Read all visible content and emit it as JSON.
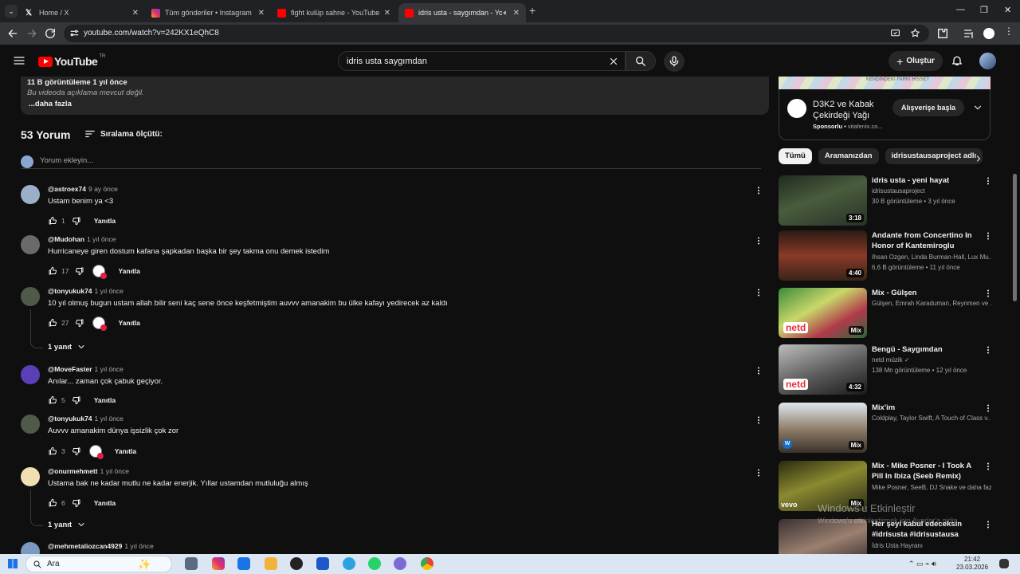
{
  "browser": {
    "tabs": [
      {
        "title": "Home / X",
        "icon": "x-logo-icon",
        "color": "#ffffff"
      },
      {
        "title": "Tüm gönderiler • Instagram",
        "icon": "instagram-icon",
        "color": "#e1306c"
      },
      {
        "title": "fight kulüp sahne - YouTube",
        "icon": "youtube-icon",
        "color": "#ff0000"
      },
      {
        "title": "idris usta - saygımdan - You",
        "icon": "youtube-icon",
        "color": "#ff0000",
        "active": true
      }
    ],
    "url": "youtube.com/watch?v=242KX1eQhC8"
  },
  "youtube": {
    "logo_text": "YouTube",
    "region": "TR",
    "search_query": "idris usta saygımdan",
    "create_label": "Oluştur"
  },
  "description": {
    "meta": "11 B görüntüleme  1 yıl önce",
    "no_description": "Bu videoda açıklama mevcut değil.",
    "more": "...daha fazla"
  },
  "comments_section": {
    "count_label": "53 Yorum",
    "sort_label": "Sıralama ölçütü:",
    "add_placeholder": "Yorum ekleyin...",
    "reply_label": "Yanıtla",
    "comments": [
      {
        "handle": "@astroex74",
        "age": "9 ay önce",
        "text": "Ustam benim ya <3",
        "likes": "1",
        "creator_heart": false,
        "avatar": "#9ab0c8"
      },
      {
        "handle": "@Mudohan",
        "age": "1 yıl önce",
        "text": "Hurricaneye giren dostum kafana şapkadan başka bir şey takma onu demek istedim",
        "likes": "17",
        "creator_heart": true,
        "avatar": "#6a6a6a"
      },
      {
        "handle": "@tonyukuk74",
        "age": "1 yıl önce",
        "text": "10 yıl olmuş bugun ustam allah bilir seni kaç sene önce keşfetmiştim auvvv amanakim bu ülke kafayı yedirecek az kaldı",
        "likes": "27",
        "creator_heart": true,
        "avatar": "#4f5a4a",
        "replies": "1 yanıt"
      },
      {
        "handle": "@MoveFaster",
        "age": "1 yıl önce",
        "text": "Anılar... zaman çok çabuk geçiyor.",
        "likes": "5",
        "creator_heart": false,
        "avatar": "#5b3fb8"
      },
      {
        "handle": "@tonyukuk74",
        "age": "1 yıl önce",
        "text": "Auvvv amanakim dünya işsizlik çok zor",
        "likes": "3",
        "creator_heart": true,
        "avatar": "#4f5a4a"
      },
      {
        "handle": "@onurmehmett",
        "age": "1 yıl önce",
        "text": "Ustama bak ne kadar mutlu ne kadar enerjik. Yıllar ustamdan mutluluğu almış",
        "likes": "6",
        "creator_heart": false,
        "avatar": "#f0dfb0",
        "replies": "1 yanıt"
      },
      {
        "handle": "@mehmetaliozcan4929",
        "age": "1 yıl önce",
        "text": "",
        "likes": "",
        "creator_heart": false,
        "avatar": "#7a98c0"
      }
    ]
  },
  "ad": {
    "banner_text": "KENDINDEKI FARKI HISSET",
    "title": "D3K2 ve Kabak Çekirdeği Yağı",
    "sponsored": "Sponsorlu",
    "advertiser": "vitafenix.co...",
    "cta": "Alışverişe başla"
  },
  "chips": [
    "Tümü",
    "Aramanızdan",
    "idrisustausaproject adlı"
  ],
  "recommendations": [
    {
      "title": "idris usta - yeni hayat",
      "channel": "idrisustausaproject",
      "views": "30 B görüntüleme • 3 yıl önce",
      "duration": "3:18",
      "thumb": "linear-gradient(160deg,#1f2b1f,#4a5c3e 45%,#263326)"
    },
    {
      "title": "Andante from Concertino In Honor of Kantemiroglu",
      "channel": "Ihsan Ozgen, Linda Burman-Hall, Lux Mu...",
      "views": "6,6 B görüntüleme • 11 yıl önce",
      "duration": "4:40",
      "thumb": "linear-gradient(180deg,#2a1b14,#8a3a28 50%,#3a2418)"
    },
    {
      "title": "Mix - Gülşen",
      "channel": "Gülşen, Emrah Karaduman, Reynmen ve ...",
      "views": "",
      "duration": "Mix",
      "thumb": "linear-gradient(150deg,#3c8a3a,#c9d86a 40%,#b03a4a 70%,#2a6a3a)"
    },
    {
      "title": "Bengü - Saygımdan",
      "channel": "netd müzik",
      "views": "138 Mn görüntüleme • 12 yıl önce",
      "duration": "4:32",
      "verified": true,
      "thumb": "linear-gradient(160deg,#bdbdbd,#5a5a5a 55%,#1a1a1a)"
    },
    {
      "title": "Mix'im",
      "channel": "Coldplay, Taylor Swift, A Touch of Class v...",
      "views": "",
      "duration": "Mix",
      "thumb": "linear-gradient(180deg,#dfe7ee,#8a7a64 55%,#3a322a)"
    },
    {
      "title": "Mix - Mike Posner - I Took A Pill In Ibiza (Seeb Remix) (Explicit)",
      "channel": "Mike Posner, SeeB, DJ Snake ve daha faz...",
      "views": "",
      "duration": "Mix",
      "thumb": "linear-gradient(160deg,#2a2a10,#8a8a30 45%,#2a2a18)"
    },
    {
      "title": "Her şeyi kabul edeceksin #idrisusta #idrisustausa",
      "channel": "İdris Usta Hayranı",
      "views": "",
      "duration": "",
      "thumb": "linear-gradient(160deg,#3a3030,#9a8070 50%,#2a2020)"
    }
  ],
  "watermark": {
    "line1": "Windows'u Etkinleştir",
    "line2": "Windows'u etkinleştirmek için Ayarlar'a gidin."
  },
  "taskbar": {
    "search_label": "Ara",
    "time": "21:42",
    "date": "23.03.2026"
  }
}
